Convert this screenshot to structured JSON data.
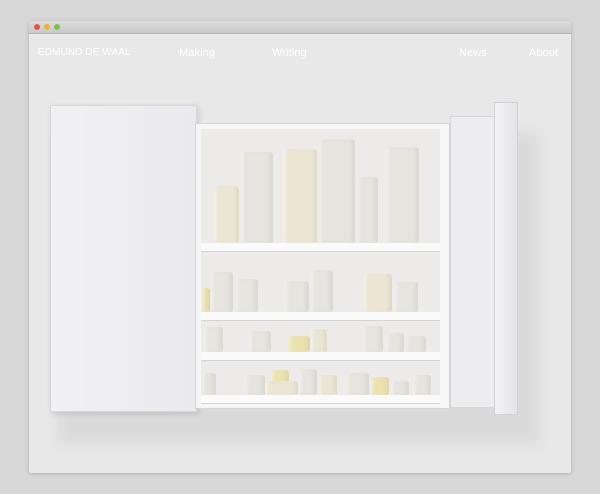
{
  "window": {
    "controls": [
      "close",
      "minimize",
      "zoom"
    ]
  },
  "site": {
    "logo": "EDMUND DE WAAL"
  },
  "nav": {
    "making": "Making",
    "writing": "Writing",
    "news": "News",
    "about": "About"
  },
  "colors": {
    "background": "#e8e8e8",
    "nav_text": "#ffffff",
    "close": "#e6544e",
    "minimize": "#e9b53a",
    "zoom": "#79c24a"
  },
  "hero": {
    "subject": "white-cabinet-with-porcelain-vessels"
  }
}
